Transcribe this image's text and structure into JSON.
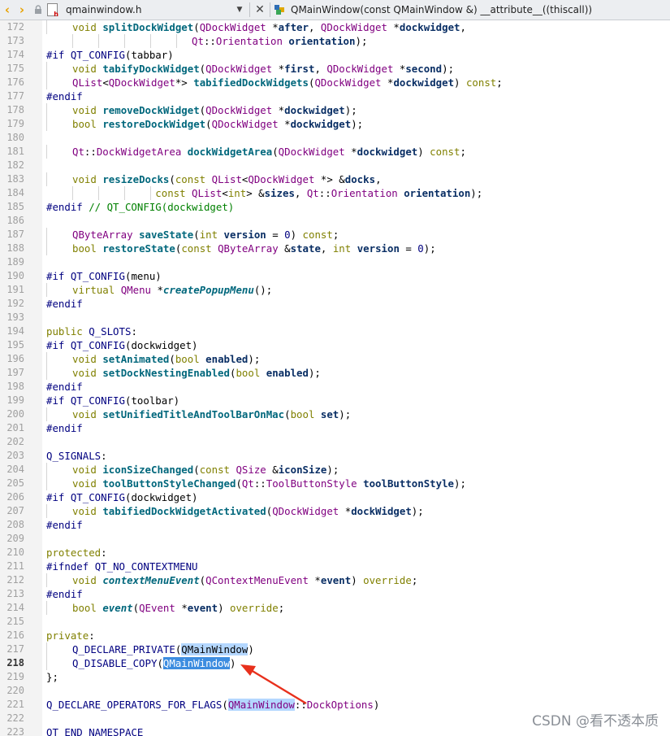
{
  "tabbar": {
    "filename": "qmainwindow.h",
    "symbol": "QMainWindow(const QMainWindow &) __attribute__((thiscall))"
  },
  "current_line": 218,
  "lines": [
    {
      "n": 172,
      "indent": 1,
      "guides": [],
      "t": [
        [
          "void ",
          "kw"
        ],
        [
          "splitDockWidget",
          "fn"
        ],
        [
          "(",
          ""
        ],
        [
          "QDockWidget",
          "typ"
        ],
        [
          " *",
          ""
        ],
        [
          "after",
          "par"
        ],
        [
          ", ",
          ""
        ],
        [
          "QDockWidget",
          "typ"
        ],
        [
          " *",
          ""
        ],
        [
          "dockwidget",
          "par"
        ],
        [
          ",",
          ""
        ]
      ]
    },
    {
      "n": 173,
      "indent": 0,
      "guides": [
        1,
        2,
        3,
        4,
        5
      ],
      "t": [
        [
          "                        ",
          ""
        ],
        [
          "Qt",
          "typ"
        ],
        [
          "::",
          ""
        ],
        [
          "Orientation",
          "typ"
        ],
        [
          " ",
          ""
        ],
        [
          "orientation",
          "par"
        ],
        [
          ");",
          ""
        ]
      ]
    },
    {
      "n": 174,
      "indent": 0,
      "guides": [],
      "t": [
        [
          "#if ",
          "mac"
        ],
        [
          "QT_CONFIG",
          "mac"
        ],
        [
          "(tabbar)",
          ""
        ]
      ]
    },
    {
      "n": 175,
      "indent": 1,
      "guides": [],
      "t": [
        [
          "void ",
          "kw"
        ],
        [
          "tabifyDockWidget",
          "fn"
        ],
        [
          "(",
          ""
        ],
        [
          "QDockWidget",
          "typ"
        ],
        [
          " *",
          ""
        ],
        [
          "first",
          "par"
        ],
        [
          ", ",
          ""
        ],
        [
          "QDockWidget",
          "typ"
        ],
        [
          " *",
          ""
        ],
        [
          "second",
          "par"
        ],
        [
          ");",
          ""
        ]
      ]
    },
    {
      "n": 176,
      "indent": 1,
      "guides": [],
      "t": [
        [
          "QList",
          "typ"
        ],
        [
          "<",
          ""
        ],
        [
          "QDockWidget",
          "typ"
        ],
        [
          "*> ",
          ""
        ],
        [
          "tabifiedDockWidgets",
          "fn"
        ],
        [
          "(",
          ""
        ],
        [
          "QDockWidget",
          "typ"
        ],
        [
          " *",
          ""
        ],
        [
          "dockwidget",
          "par"
        ],
        [
          ") ",
          ""
        ],
        [
          "const",
          "kw"
        ],
        [
          ";",
          ""
        ]
      ]
    },
    {
      "n": 177,
      "indent": 0,
      "guides": [],
      "t": [
        [
          "#endif",
          "mac"
        ]
      ]
    },
    {
      "n": 178,
      "indent": 1,
      "guides": [],
      "t": [
        [
          "void ",
          "kw"
        ],
        [
          "removeDockWidget",
          "fn"
        ],
        [
          "(",
          ""
        ],
        [
          "QDockWidget",
          "typ"
        ],
        [
          " *",
          ""
        ],
        [
          "dockwidget",
          "par"
        ],
        [
          ");",
          ""
        ]
      ]
    },
    {
      "n": 179,
      "indent": 1,
      "guides": [],
      "t": [
        [
          "bool ",
          "kw"
        ],
        [
          "restoreDockWidget",
          "fn"
        ],
        [
          "(",
          ""
        ],
        [
          "QDockWidget",
          "typ"
        ],
        [
          " *",
          ""
        ],
        [
          "dockwidget",
          "par"
        ],
        [
          ");",
          ""
        ]
      ]
    },
    {
      "n": 180,
      "indent": 0,
      "guides": [],
      "t": []
    },
    {
      "n": 181,
      "indent": 1,
      "guides": [],
      "t": [
        [
          "Qt",
          "typ"
        ],
        [
          "::",
          ""
        ],
        [
          "DockWidgetArea",
          "typ"
        ],
        [
          " ",
          ""
        ],
        [
          "dockWidgetArea",
          "fn"
        ],
        [
          "(",
          ""
        ],
        [
          "QDockWidget",
          "typ"
        ],
        [
          " *",
          ""
        ],
        [
          "dockwidget",
          "par"
        ],
        [
          ") ",
          ""
        ],
        [
          "const",
          "kw"
        ],
        [
          ";",
          ""
        ]
      ]
    },
    {
      "n": 182,
      "indent": 0,
      "guides": [],
      "t": []
    },
    {
      "n": 183,
      "indent": 1,
      "guides": [],
      "t": [
        [
          "void ",
          "kw"
        ],
        [
          "resizeDocks",
          "fn"
        ],
        [
          "(",
          ""
        ],
        [
          "const ",
          "kw"
        ],
        [
          "QList",
          "typ"
        ],
        [
          "<",
          ""
        ],
        [
          "QDockWidget",
          "typ"
        ],
        [
          " *> &",
          ""
        ],
        [
          "docks",
          "par"
        ],
        [
          ",",
          ""
        ]
      ]
    },
    {
      "n": 184,
      "indent": 0,
      "guides": [
        1,
        2,
        3,
        4
      ],
      "t": [
        [
          "                  ",
          ""
        ],
        [
          "const ",
          "kw"
        ],
        [
          "QList",
          "typ"
        ],
        [
          "<",
          ""
        ],
        [
          "int",
          "kw"
        ],
        [
          "> &",
          ""
        ],
        [
          "sizes",
          "par"
        ],
        [
          ", ",
          ""
        ],
        [
          "Qt",
          "typ"
        ],
        [
          "::",
          ""
        ],
        [
          "Orientation",
          "typ"
        ],
        [
          " ",
          ""
        ],
        [
          "orientation",
          "par"
        ],
        [
          ");",
          ""
        ]
      ]
    },
    {
      "n": 185,
      "indent": 0,
      "guides": [],
      "t": [
        [
          "#endif ",
          "mac"
        ],
        [
          "// QT_CONFIG(dockwidget)",
          "cmt"
        ]
      ]
    },
    {
      "n": 186,
      "indent": 0,
      "guides": [],
      "t": []
    },
    {
      "n": 187,
      "indent": 1,
      "guides": [],
      "t": [
        [
          "QByteArray",
          "typ"
        ],
        [
          " ",
          ""
        ],
        [
          "saveState",
          "fn"
        ],
        [
          "(",
          ""
        ],
        [
          "int ",
          "kw"
        ],
        [
          "version",
          "par"
        ],
        [
          " = ",
          ""
        ],
        [
          "0",
          "num"
        ],
        [
          ") ",
          ""
        ],
        [
          "const",
          "kw"
        ],
        [
          ";",
          ""
        ]
      ]
    },
    {
      "n": 188,
      "indent": 1,
      "guides": [],
      "t": [
        [
          "bool ",
          "kw"
        ],
        [
          "restoreState",
          "fn"
        ],
        [
          "(",
          ""
        ],
        [
          "const ",
          "kw"
        ],
        [
          "QByteArray",
          "typ"
        ],
        [
          " &",
          ""
        ],
        [
          "state",
          "par"
        ],
        [
          ", ",
          ""
        ],
        [
          "int ",
          "kw"
        ],
        [
          "version",
          "par"
        ],
        [
          " = ",
          ""
        ],
        [
          "0",
          "num"
        ],
        [
          ");",
          ""
        ]
      ]
    },
    {
      "n": 189,
      "indent": 0,
      "guides": [],
      "t": []
    },
    {
      "n": 190,
      "indent": 0,
      "guides": [],
      "t": [
        [
          "#if ",
          "mac"
        ],
        [
          "QT_CONFIG",
          "mac"
        ],
        [
          "(menu)",
          ""
        ]
      ]
    },
    {
      "n": 191,
      "indent": 1,
      "guides": [],
      "t": [
        [
          "virtual ",
          "kw"
        ],
        [
          "QMenu",
          "typ"
        ],
        [
          " *",
          ""
        ],
        [
          "createPopupMenu",
          "fni"
        ],
        [
          "();",
          ""
        ]
      ]
    },
    {
      "n": 192,
      "indent": 0,
      "guides": [],
      "t": [
        [
          "#endif",
          "mac"
        ]
      ]
    },
    {
      "n": 193,
      "indent": 0,
      "guides": [],
      "t": []
    },
    {
      "n": 194,
      "indent": 0,
      "guides": [],
      "t": [
        [
          "public ",
          "kw"
        ],
        [
          "Q_SLOTS",
          "mac"
        ],
        [
          ":",
          ""
        ]
      ]
    },
    {
      "n": 195,
      "indent": 0,
      "guides": [],
      "t": [
        [
          "#if ",
          "mac"
        ],
        [
          "QT_CONFIG",
          "mac"
        ],
        [
          "(dockwidget)",
          ""
        ]
      ]
    },
    {
      "n": 196,
      "indent": 1,
      "guides": [],
      "t": [
        [
          "void ",
          "kw"
        ],
        [
          "setAnimated",
          "fn"
        ],
        [
          "(",
          ""
        ],
        [
          "bool ",
          "kw"
        ],
        [
          "enabled",
          "par"
        ],
        [
          ");",
          ""
        ]
      ]
    },
    {
      "n": 197,
      "indent": 1,
      "guides": [],
      "t": [
        [
          "void ",
          "kw"
        ],
        [
          "setDockNestingEnabled",
          "fn"
        ],
        [
          "(",
          ""
        ],
        [
          "bool ",
          "kw"
        ],
        [
          "enabled",
          "par"
        ],
        [
          ");",
          ""
        ]
      ]
    },
    {
      "n": 198,
      "indent": 0,
      "guides": [],
      "t": [
        [
          "#endif",
          "mac"
        ]
      ]
    },
    {
      "n": 199,
      "indent": 0,
      "guides": [],
      "t": [
        [
          "#if ",
          "mac"
        ],
        [
          "QT_CONFIG",
          "mac"
        ],
        [
          "(toolbar)",
          ""
        ]
      ]
    },
    {
      "n": 200,
      "indent": 1,
      "guides": [],
      "t": [
        [
          "void ",
          "kw"
        ],
        [
          "setUnifiedTitleAndToolBarOnMac",
          "fn"
        ],
        [
          "(",
          ""
        ],
        [
          "bool ",
          "kw"
        ],
        [
          "set",
          "par"
        ],
        [
          ");",
          ""
        ]
      ]
    },
    {
      "n": 201,
      "indent": 0,
      "guides": [],
      "t": [
        [
          "#endif",
          "mac"
        ]
      ]
    },
    {
      "n": 202,
      "indent": 0,
      "guides": [],
      "t": []
    },
    {
      "n": 203,
      "indent": 0,
      "guides": [],
      "t": [
        [
          "Q_SIGNALS",
          "mac"
        ],
        [
          ":",
          ""
        ]
      ]
    },
    {
      "n": 204,
      "indent": 1,
      "guides": [],
      "t": [
        [
          "void ",
          "kw"
        ],
        [
          "iconSizeChanged",
          "fn"
        ],
        [
          "(",
          ""
        ],
        [
          "const ",
          "kw"
        ],
        [
          "QSize",
          "typ"
        ],
        [
          " &",
          ""
        ],
        [
          "iconSize",
          "par"
        ],
        [
          ");",
          ""
        ]
      ]
    },
    {
      "n": 205,
      "indent": 1,
      "guides": [],
      "t": [
        [
          "void ",
          "kw"
        ],
        [
          "toolButtonStyleChanged",
          "fn"
        ],
        [
          "(",
          ""
        ],
        [
          "Qt",
          "typ"
        ],
        [
          "::",
          ""
        ],
        [
          "ToolButtonStyle",
          "typ"
        ],
        [
          " ",
          ""
        ],
        [
          "toolButtonStyle",
          "par"
        ],
        [
          ");",
          ""
        ]
      ]
    },
    {
      "n": 206,
      "indent": 0,
      "guides": [],
      "t": [
        [
          "#if ",
          "mac"
        ],
        [
          "QT_CONFIG",
          "mac"
        ],
        [
          "(dockwidget)",
          ""
        ]
      ]
    },
    {
      "n": 207,
      "indent": 1,
      "guides": [],
      "t": [
        [
          "void ",
          "kw"
        ],
        [
          "tabifiedDockWidgetActivated",
          "fn"
        ],
        [
          "(",
          ""
        ],
        [
          "QDockWidget",
          "typ"
        ],
        [
          " *",
          ""
        ],
        [
          "dockWidget",
          "par"
        ],
        [
          ");",
          ""
        ]
      ]
    },
    {
      "n": 208,
      "indent": 0,
      "guides": [],
      "t": [
        [
          "#endif",
          "mac"
        ]
      ]
    },
    {
      "n": 209,
      "indent": 0,
      "guides": [],
      "t": []
    },
    {
      "n": 210,
      "indent": 0,
      "guides": [],
      "t": [
        [
          "protected",
          "kw"
        ],
        [
          ":",
          ""
        ]
      ]
    },
    {
      "n": 211,
      "indent": 0,
      "guides": [],
      "t": [
        [
          "#ifndef ",
          "mac"
        ],
        [
          "QT_NO_CONTEXTMENU",
          "mac"
        ]
      ]
    },
    {
      "n": 212,
      "indent": 1,
      "guides": [],
      "t": [
        [
          "void ",
          "kw"
        ],
        [
          "contextMenuEvent",
          "fni"
        ],
        [
          "(",
          ""
        ],
        [
          "QContextMenuEvent",
          "typ"
        ],
        [
          " *",
          ""
        ],
        [
          "event",
          "par"
        ],
        [
          ") ",
          ""
        ],
        [
          "override",
          "kw"
        ],
        [
          ";",
          ""
        ]
      ]
    },
    {
      "n": 213,
      "indent": 0,
      "guides": [],
      "t": [
        [
          "#endif",
          "mac"
        ]
      ]
    },
    {
      "n": 214,
      "indent": 1,
      "guides": [],
      "t": [
        [
          "bool ",
          "kw"
        ],
        [
          "event",
          "fni"
        ],
        [
          "(",
          ""
        ],
        [
          "QEvent",
          "typ"
        ],
        [
          " *",
          ""
        ],
        [
          "event",
          "par"
        ],
        [
          ") ",
          ""
        ],
        [
          "override",
          "kw"
        ],
        [
          ";",
          ""
        ]
      ]
    },
    {
      "n": 215,
      "indent": 0,
      "guides": [],
      "t": []
    },
    {
      "n": 216,
      "indent": 0,
      "guides": [],
      "t": [
        [
          "private",
          "kw"
        ],
        [
          ":",
          ""
        ]
      ]
    },
    {
      "n": 217,
      "indent": 1,
      "guides": [],
      "t": [
        [
          "Q_DECLARE_PRIVATE",
          "mac"
        ],
        [
          "(",
          ""
        ],
        [
          "QMainWindow",
          "hl"
        ],
        [
          ")",
          ""
        ]
      ]
    },
    {
      "n": 218,
      "indent": 1,
      "guides": [],
      "t": [
        [
          "Q_DISABLE_COPY",
          "mac"
        ],
        [
          "(",
          ""
        ],
        [
          "QMainWindow",
          "hls"
        ],
        [
          ")",
          ""
        ]
      ]
    },
    {
      "n": 219,
      "indent": 0,
      "guides": [],
      "t": [
        [
          "};",
          ""
        ]
      ]
    },
    {
      "n": 220,
      "indent": 0,
      "guides": [],
      "t": []
    },
    {
      "n": 221,
      "indent": 0,
      "guides": [],
      "t": [
        [
          "Q_DECLARE_OPERATORS_FOR_FLAGS",
          "mac"
        ],
        [
          "(",
          ""
        ],
        [
          "QMainWindow",
          "typ hl"
        ],
        [
          "::",
          ""
        ],
        [
          "DockOptions",
          "typ"
        ],
        [
          ")",
          ""
        ]
      ]
    },
    {
      "n": 222,
      "indent": 0,
      "guides": [],
      "t": []
    },
    {
      "n": 223,
      "indent": 0,
      "guides": [],
      "t": [
        [
          "QT_END_NAMESPACE",
          "mac"
        ]
      ]
    }
  ],
  "watermark": "CSDN @看不透本质"
}
